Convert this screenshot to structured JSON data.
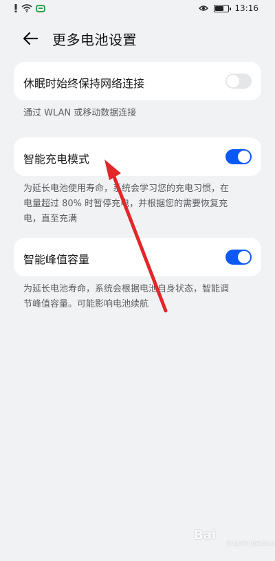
{
  "status_bar": {
    "time": "13:16",
    "icons": [
      "alert-icon",
      "wifi-icon",
      "message-icon",
      "eye-icon",
      "battery-icon"
    ]
  },
  "header": {
    "title": "更多电池设置",
    "back_icon": "arrow-left-icon"
  },
  "settings": [
    {
      "label": "休眠时始终保持网络连接",
      "enabled": false,
      "description": "通过 WLAN 或移动数据连接"
    },
    {
      "label": "智能充电模式",
      "enabled": true,
      "description_lines": [
        "为延长电池使用寿命，系统会学习您的充电习惯，在",
        "电量超过 80% 时暂停充电，并根据您的需要恢复充",
        "电，直至充满"
      ]
    },
    {
      "label": "智能峰值容量",
      "enabled": true,
      "description_lines": [
        "为延长电池寿命，系统会根据电池自身状态，智能调",
        "节峰值容量。可能影响电池续航"
      ]
    }
  ],
  "annotation": {
    "color": "#e3262a"
  },
  "watermark": {
    "text": "Bai",
    "sub": "jingyan.baidu.com"
  },
  "colors": {
    "background": "#f1f2f4",
    "card": "#ffffff",
    "toggle_on": "#0a59f7",
    "toggle_off": "#e5e6e8"
  }
}
